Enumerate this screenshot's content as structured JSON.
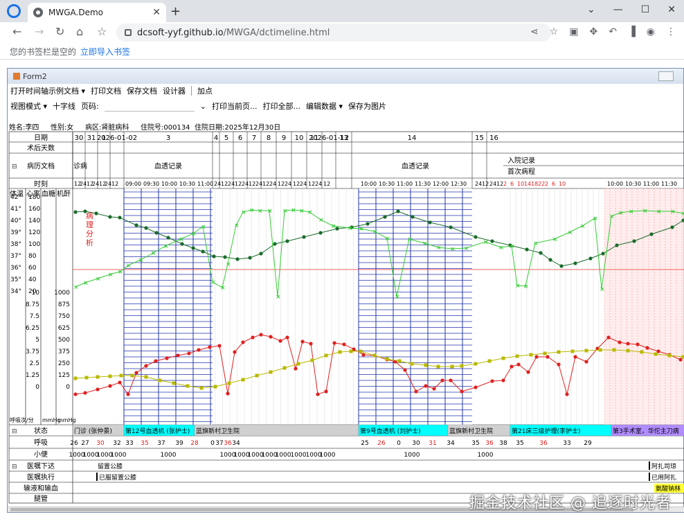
{
  "browser": {
    "tab_title": "MWGA.Demo",
    "url_host": "dcsoft-yyf.github.io",
    "url_path": "/MWGA/dctimeline.html",
    "bookmarks_text": "您的书签栏是空的",
    "bookmarks_link": "立即导入书签"
  },
  "form": {
    "title": "Form2",
    "menu1": [
      "打开时间轴示例文档 ▾",
      "打印文档",
      "保存文档",
      "设计器",
      "加点"
    ],
    "menu2": [
      "视图模式 ▾",
      "十字线",
      "页码:",
      "打印当前页...",
      "打印全部...",
      "编辑数据 ▾",
      "保存为图片"
    ]
  },
  "patient": {
    "name": "姓名:李四",
    "sex": "性别:女",
    "ward": "病区:肾脏病科",
    "bed_no": "住院号:000134",
    "admit_date": "住院日期:2025年12月30日"
  },
  "rows": {
    "date": "日期",
    "postop_days": "术后天数",
    "docs": "病历文档",
    "time": "时刻",
    "status": "状态",
    "breath": "呼吸",
    "urine": "小便",
    "order_issue": "医嘱下达",
    "order_exec": "医嘱执行",
    "transfusion": "输液和输血",
    "tube": "腿管"
  },
  "axis_headers": [
    "体温",
    "心率",
    "血糖",
    "机酐"
  ],
  "temp_ticks": [
    "42°",
    "41°",
    "40°",
    "39°",
    "38°",
    "37°",
    "36°",
    "35°",
    "34°"
  ],
  "hr_ticks": [
    "180",
    "160",
    "140",
    "120",
    "100",
    "80",
    "60",
    "40",
    "20"
  ],
  "glu_ticks": [
    "10",
    "8.75",
    "7.5",
    "6.25",
    "5",
    "3.75",
    "2.5",
    "1.25",
    "0"
  ],
  "cr_ticks": [
    "1000",
    "875",
    "750",
    "625",
    "500",
    "375",
    "250",
    "125",
    "0"
  ],
  "bottom_units": [
    "呼吸次/分",
    "mmHg",
    "mmHg"
  ],
  "date_cells": [
    "30",
    "31",
    "1",
    "2026-01-02",
    "3",
    "4",
    "5",
    "6",
    "7",
    "8",
    "9",
    "10",
    "11",
    "2026-01-12",
    "13",
    "14",
    "15",
    "16"
  ],
  "doc_labels": [
    "诊病",
    "血透记录",
    "血透记录",
    "入院记录",
    "首次病程"
  ],
  "annotation": "病理分析",
  "status_cells": [
    "门诊 (张仲景)",
    "第12号血透机 (张护士)",
    "蓝旗新村卫生院",
    "第9号血透机 (刘护士)",
    "蓝旗新村卫生院",
    "第21床三级护理(李护士)",
    "第3手术室，华佗主刀病"
  ],
  "breath_values": [
    "26",
    "27",
    "30",
    "32",
    "33",
    "35",
    "37",
    "39",
    "28",
    "0",
    "37",
    "36",
    "34",
    "25",
    "26",
    "0",
    "30",
    "31",
    "34",
    "35",
    "36",
    "38",
    "35",
    "36",
    "33",
    "29"
  ],
  "urine_values": [
    "1000",
    "1000",
    "1000",
    "1000",
    "1000",
    "1000",
    "1000",
    "1000",
    "1000",
    "1000",
    "1000",
    "1000",
    "1000",
    "1000",
    "1000"
  ],
  "orders_issue": [
    "留置公膝",
    "阿扎司琼"
  ],
  "orders_exec": [
    "已服留置公膝",
    "已用阿扎"
  ],
  "transfusion_text": "氨酸钠林",
  "watermark": "掘金技术社区 @ 追逐时光者",
  "colors": {
    "hr": "#1a6b2a",
    "temp": "#33cc33",
    "glucose": "#e02020",
    "creat": "#b8b800",
    "dialysis": "#2233aa",
    "op": "#ff9999"
  }
}
